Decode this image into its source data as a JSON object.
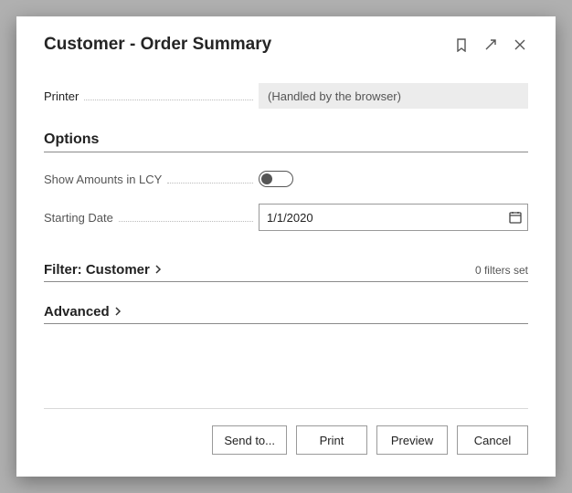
{
  "dialog": {
    "title": "Customer - Order Summary"
  },
  "printer": {
    "label": "Printer",
    "value": "(Handled by the browser)"
  },
  "options": {
    "heading": "Options",
    "show_lcy_label": "Show Amounts in LCY",
    "show_lcy_value": false,
    "starting_date_label": "Starting Date",
    "starting_date_value": "1/1/2020"
  },
  "filter": {
    "heading": "Filter: Customer",
    "summary": "0 filters set"
  },
  "advanced": {
    "heading": "Advanced"
  },
  "buttons": {
    "send_to": "Send to...",
    "print": "Print",
    "preview": "Preview",
    "cancel": "Cancel"
  }
}
